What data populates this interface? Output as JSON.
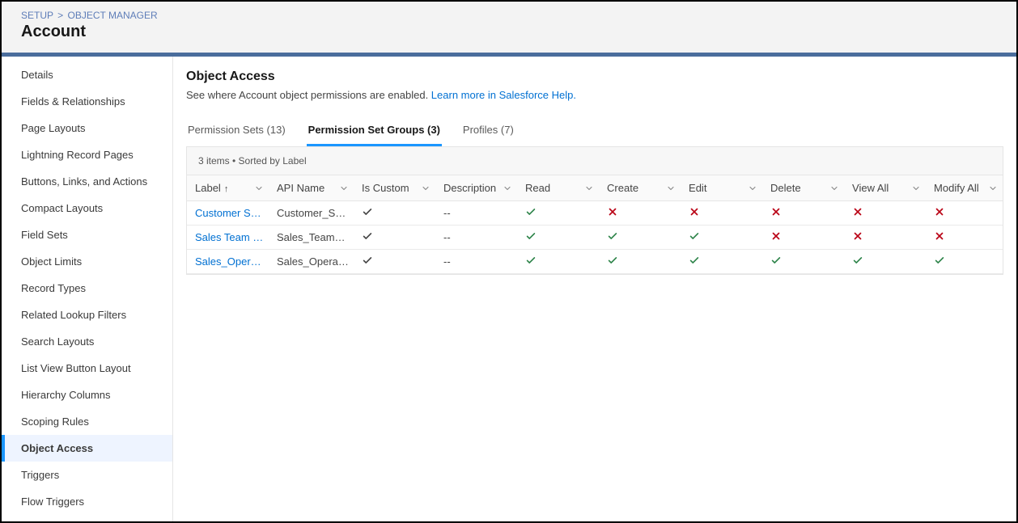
{
  "breadcrumb": {
    "setup": "SETUP",
    "sep": ">",
    "object_manager": "OBJECT MANAGER"
  },
  "page_title": "Account",
  "sidebar": {
    "items": [
      "Details",
      "Fields & Relationships",
      "Page Layouts",
      "Lightning Record Pages",
      "Buttons, Links, and Actions",
      "Compact Layouts",
      "Field Sets",
      "Object Limits",
      "Record Types",
      "Related Lookup Filters",
      "Search Layouts",
      "List View Button Layout",
      "Hierarchy Columns",
      "Scoping Rules",
      "Object Access",
      "Triggers",
      "Flow Triggers"
    ],
    "active_index": 14
  },
  "section": {
    "title": "Object Access",
    "desc_prefix": "See where Account object permissions are enabled. ",
    "help_link": "Learn more in Salesforce Help."
  },
  "tabs": [
    {
      "label": "Permission Sets (13)"
    },
    {
      "label": "Permission Set Groups (3)"
    },
    {
      "label": "Profiles (7)"
    }
  ],
  "active_tab_index": 1,
  "table": {
    "meta": "3 items • Sorted by Label",
    "columns": [
      "Label",
      "API Name",
      "Is Custom",
      "Description",
      "Read",
      "Create",
      "Edit",
      "Delete",
      "View All",
      "Modify All"
    ],
    "sort_col_index": 0,
    "sort_dir": "asc",
    "rows": [
      {
        "label": "Customer Sup...",
        "api": "Customer_Sup...",
        "is_custom": true,
        "description": "--",
        "perms": {
          "read": true,
          "create": false,
          "edit": false,
          "delete": false,
          "view_all": false,
          "modify_all": false
        }
      },
      {
        "label": "Sales Team Me...",
        "api": "Sales_Team_M...",
        "is_custom": true,
        "description": "--",
        "perms": {
          "read": true,
          "create": true,
          "edit": true,
          "delete": false,
          "view_all": false,
          "modify_all": false
        }
      },
      {
        "label": "Sales_Operatio...",
        "api": "Sales_Operatio...",
        "is_custom": true,
        "description": "--",
        "perms": {
          "read": true,
          "create": true,
          "edit": true,
          "delete": true,
          "view_all": true,
          "modify_all": true
        }
      }
    ]
  }
}
